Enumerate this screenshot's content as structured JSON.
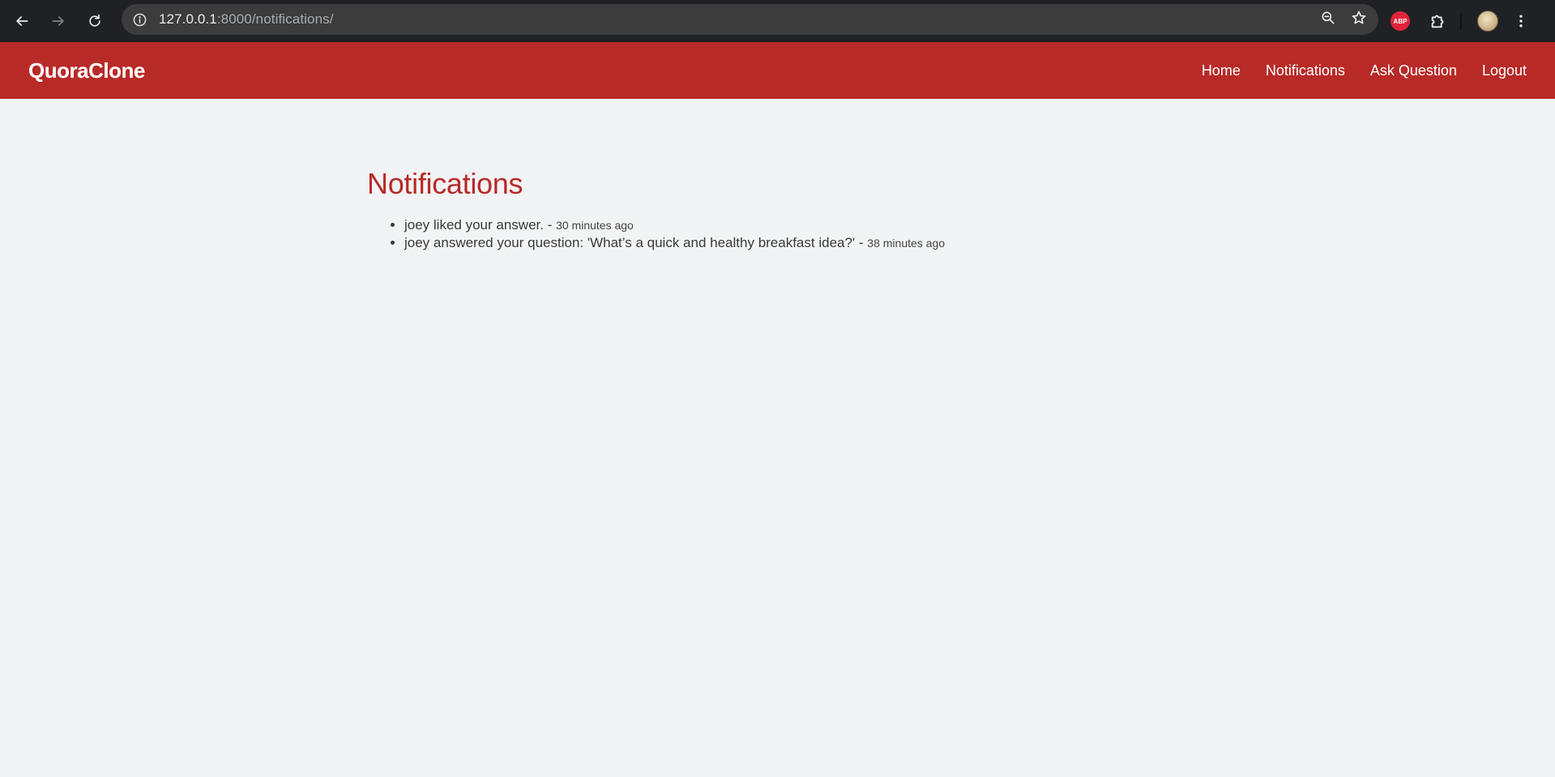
{
  "browser": {
    "url_host": "127.0.0.1",
    "url_rest": ":8000/notifications/",
    "extension_label": "ABP"
  },
  "nav": {
    "brand": "QuoraClone",
    "links": [
      "Home",
      "Notifications",
      "Ask Question",
      "Logout"
    ]
  },
  "page": {
    "title": "Notifications",
    "separator": " - ",
    "notifications": [
      {
        "text": "joey liked your answer.",
        "time": "30 minutes ago"
      },
      {
        "text": "joey answered your question: 'What’s a quick and healthy breakfast idea?'",
        "time": "38 minutes ago"
      }
    ]
  },
  "colors": {
    "brand_red": "#b82a27",
    "page_bg": "#f2f3f5",
    "chrome_bg": "#202124"
  }
}
